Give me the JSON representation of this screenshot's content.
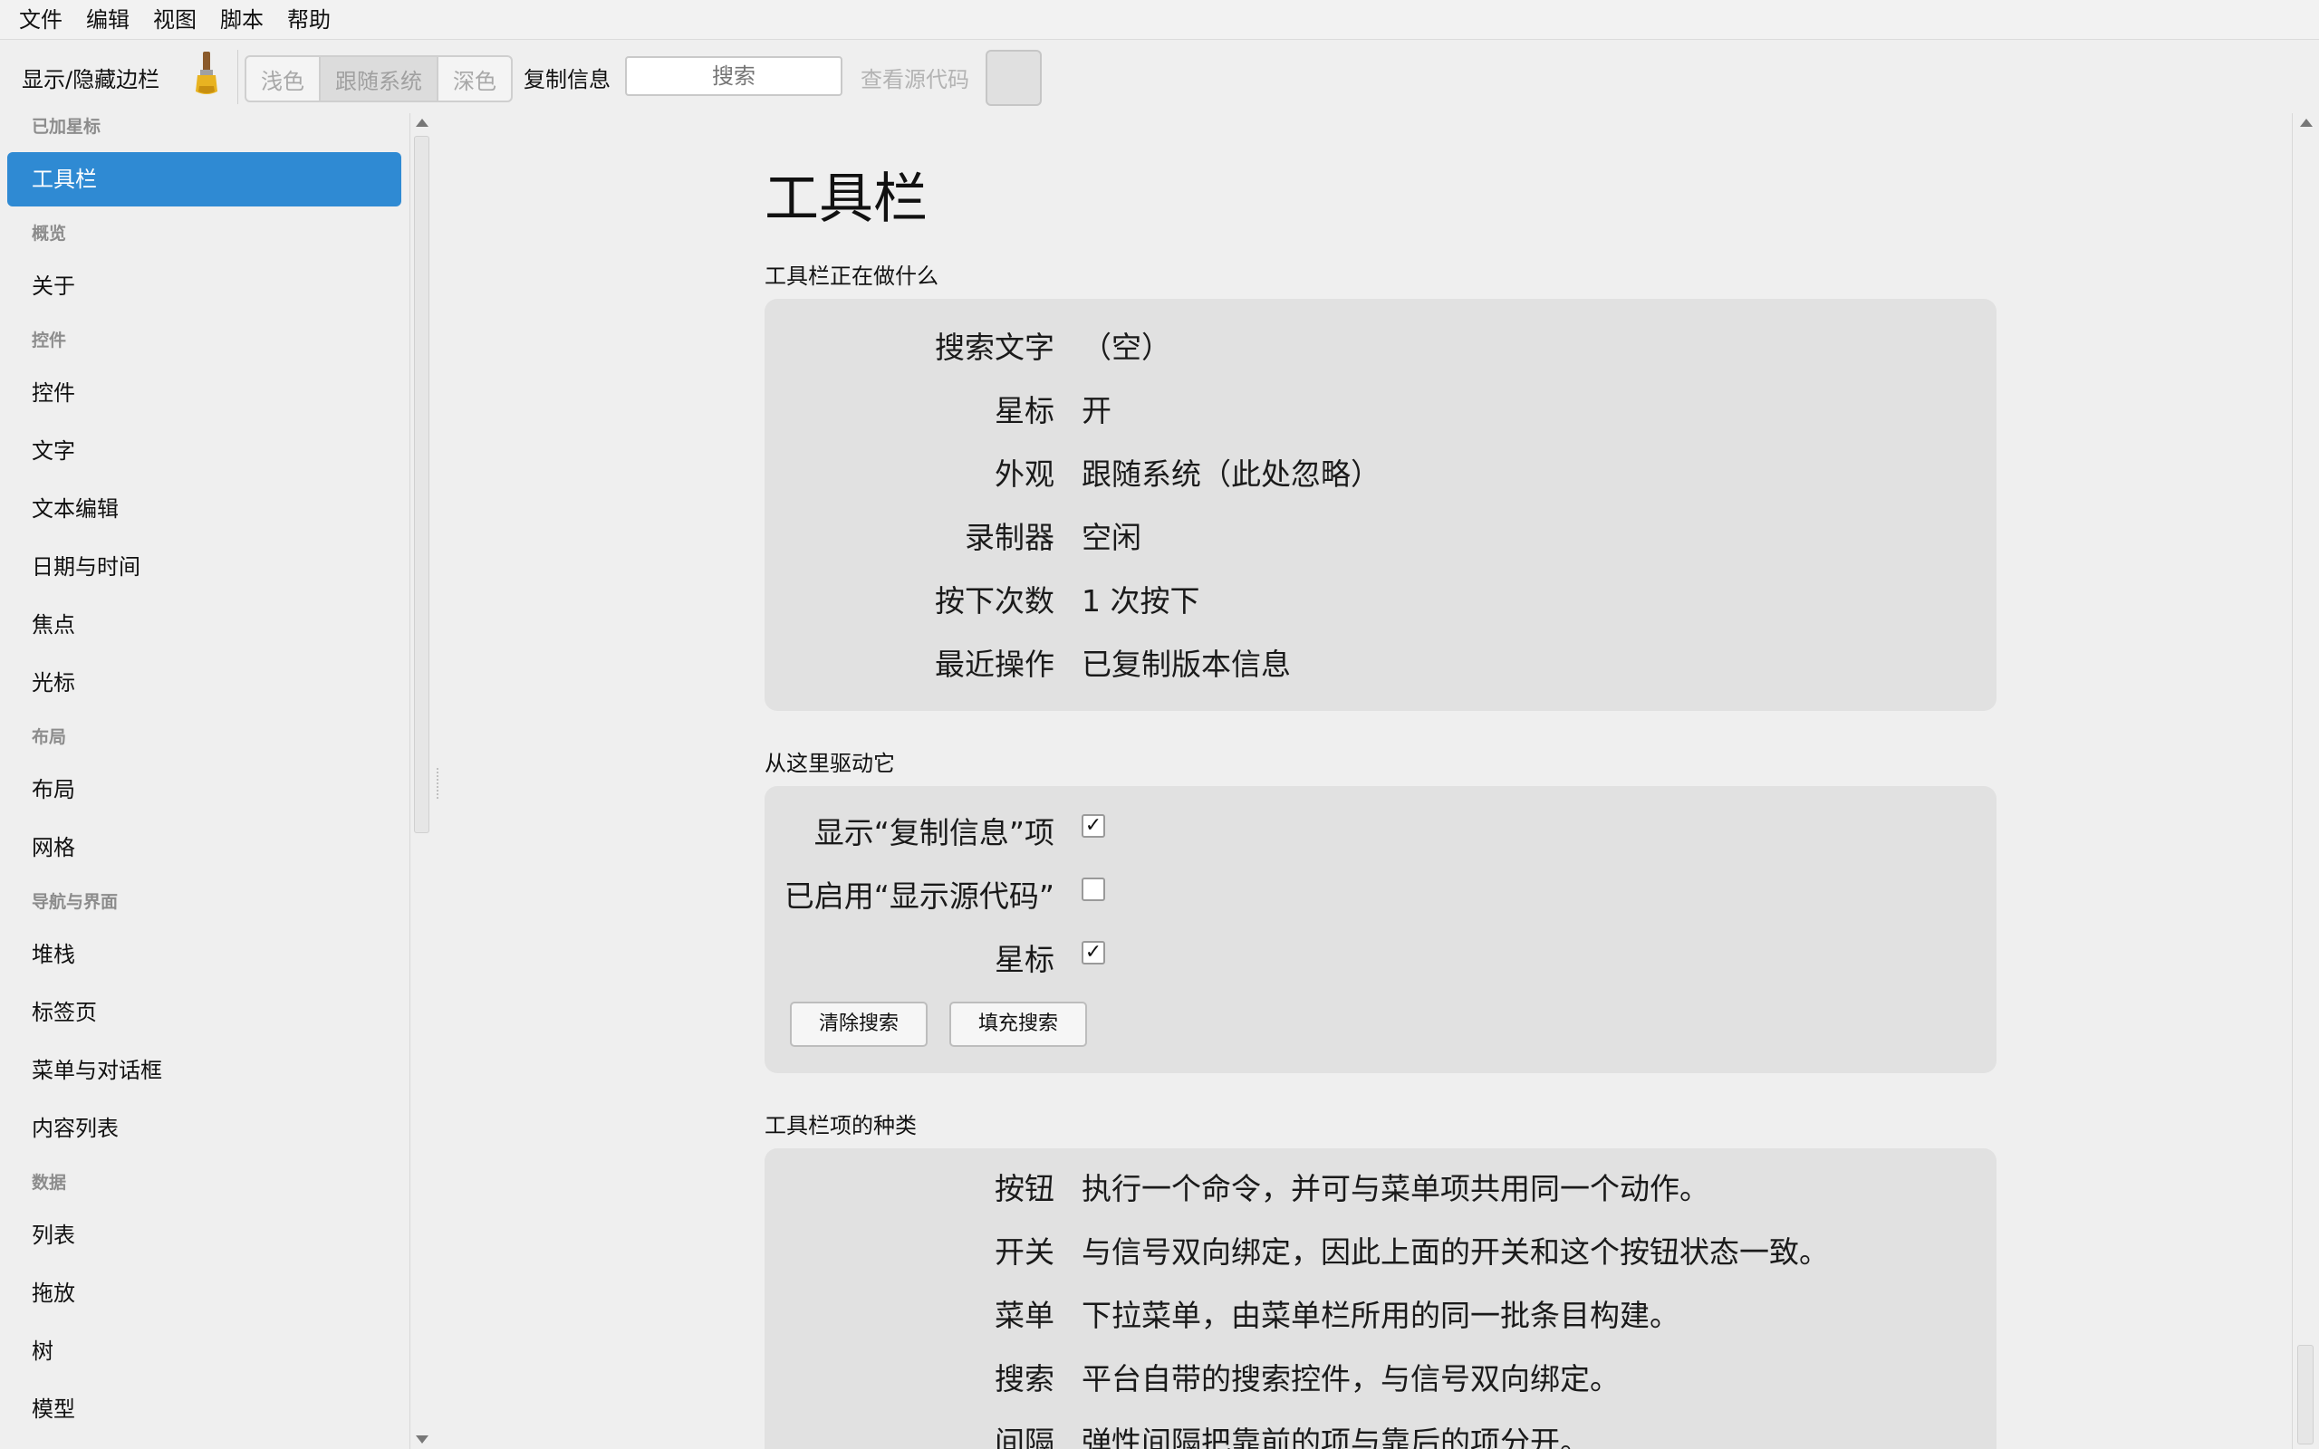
{
  "menubar": [
    "文件",
    "编辑",
    "视图",
    "脚本",
    "帮助"
  ],
  "toolbar": {
    "toggle_sidebar": "显示/隐藏边栏",
    "brush_icon": "paintbrush-icon",
    "appearance": [
      "浅色",
      "跟随系统",
      "深色"
    ],
    "appearance_selected": "跟随系统",
    "copy_info": "复制信息",
    "search_placeholder": "搜索",
    "view_source": "查看源代码",
    "star_icon": "star-icon"
  },
  "sidebar": {
    "groups": [
      {
        "header": "已加星标",
        "items": [
          "工具栏"
        ]
      },
      {
        "header": "概览",
        "items": [
          "关于"
        ]
      },
      {
        "header": "控件",
        "items": [
          "控件",
          "文字",
          "文本编辑",
          "日期与时间",
          "焦点",
          "光标"
        ]
      },
      {
        "header": "布局",
        "items": [
          "布局",
          "网格"
        ]
      },
      {
        "header": "导航与界面",
        "items": [
          "堆栈",
          "标签页",
          "菜单与对话框",
          "内容列表"
        ]
      },
      {
        "header": "数据",
        "items": [
          "列表",
          "拖放",
          "树",
          "模型"
        ]
      }
    ],
    "active": "工具栏"
  },
  "main": {
    "title": "工具栏",
    "status_section": {
      "title": "工具栏正在做什么",
      "rows": [
        {
          "label": "搜索文字",
          "value": "（空）"
        },
        {
          "label": "星标",
          "value": "开"
        },
        {
          "label": "外观",
          "value": "跟随系统（此处忽略）"
        },
        {
          "label": "录制器",
          "value": "空闲"
        },
        {
          "label": "按下次数",
          "value": "1 次按下"
        },
        {
          "label": "最近操作",
          "value": "已复制版本信息"
        }
      ]
    },
    "drive_section": {
      "title": "从这里驱动它",
      "checks": [
        {
          "label": "显示“复制信息”项",
          "checked": true
        },
        {
          "label": "已启用“显示源代码”",
          "checked": false
        },
        {
          "label": "星标",
          "checked": true
        }
      ],
      "buttons": [
        "清除搜索",
        "填充搜索"
      ]
    },
    "kinds_section": {
      "title": "工具栏项的种类",
      "rows": [
        {
          "label": "按钮",
          "value": "执行一个命令，并可与菜单项共用同一个动作。"
        },
        {
          "label": "开关",
          "value": "与信号双向绑定，因此上面的开关和这个按钮状态一致。"
        },
        {
          "label": "菜单",
          "value": "下拉菜单，由菜单栏所用的同一批条目构建。"
        },
        {
          "label": "搜索",
          "value": "平台自带的搜索控件，与信号双向绑定。"
        },
        {
          "label": "间隔",
          "value": "弹性间隔把靠前的项与靠后的项分开。"
        }
      ]
    }
  }
}
